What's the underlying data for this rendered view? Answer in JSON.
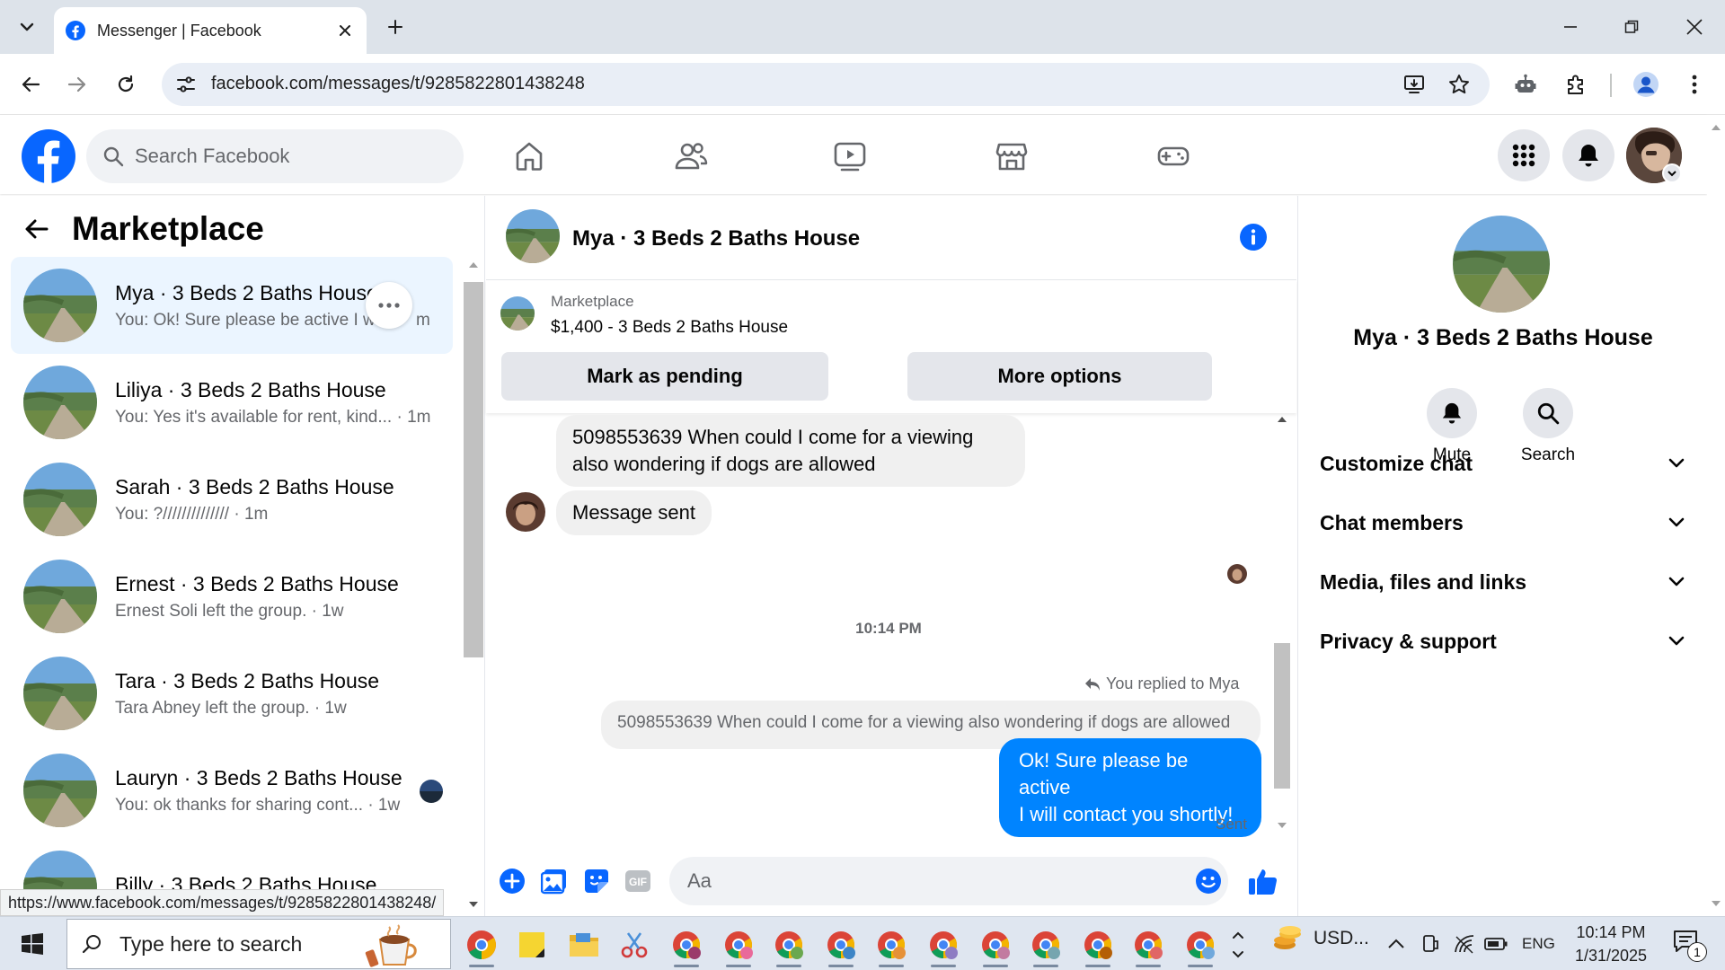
{
  "browser": {
    "tab_title": "Messenger | Facebook",
    "url": "facebook.com/messages/t/9285822801438248",
    "status_url": "https://www.facebook.com/messages/t/9285822801438248/"
  },
  "fb_header": {
    "search_placeholder": "Search Facebook"
  },
  "sidebar": {
    "title": "Marketplace",
    "conversations": [
      {
        "name": "Mya · 3 Beds 2 Baths House",
        "preview": "You: Ok! Sure please be active I w",
        "time": "m",
        "active": true
      },
      {
        "name": "Liliya · 3 Beds 2 Baths House",
        "preview": "You: Yes it's available for rent, kind...",
        "time": "· 1m"
      },
      {
        "name": "Sarah · 3 Beds 2 Baths House",
        "preview": "You: ?//////////////",
        "time": "· 1m"
      },
      {
        "name": "Ernest · 3 Beds 2 Baths House",
        "preview": "Ernest Soli left the group.",
        "time": "· 1w"
      },
      {
        "name": "Tara · 3 Beds 2 Baths House",
        "preview": "Tara Abney left the group.",
        "time": "· 1w"
      },
      {
        "name": "Lauryn · 3 Beds 2 Baths House",
        "preview": "You: ok thanks for sharing cont...",
        "time": "· 1w"
      },
      {
        "name": "Billy · 3 Beds 2 Baths House",
        "preview": "",
        "time": ""
      }
    ]
  },
  "chat": {
    "title": "Mya · 3 Beds 2 Baths House",
    "marketplace_label": "Marketplace",
    "listing": "$1,400 - 3 Beds 2 Baths House",
    "mark_pending": "Mark as pending",
    "more_options": "More options",
    "msg_incoming_1": "5098553639 When could I come for a viewing also wondering if dogs are allowed",
    "msg_incoming_2": "Message sent",
    "timestamp": "10:14 PM",
    "replied_to": "You replied to Mya",
    "quoted": "5098553639 When could I come for a viewing also wondering if dogs are allowed",
    "msg_outgoing_line1": "Ok! Sure please be active",
    "msg_outgoing_line2": "I will contact you shortly!",
    "sent_status": "Sent",
    "composer_placeholder": "Aa"
  },
  "info_panel": {
    "name": "Mya · 3 Beds 2 Baths House",
    "actions": [
      {
        "label": "Mute",
        "icon": "bell-icon"
      },
      {
        "label": "Search",
        "icon": "search-icon"
      }
    ],
    "sections": [
      "Customize chat",
      "Chat members",
      "Media, files and links",
      "Privacy & support"
    ]
  },
  "taskbar": {
    "search_placeholder": "Type here to search",
    "ticker": "USD...",
    "language": "ENG",
    "time": "10:14 PM",
    "date": "1/31/2025",
    "notifications": "1"
  },
  "colors": {
    "fb_blue": "#0866ff",
    "messenger_blue": "#0084ff",
    "active_row": "#ebf5ff"
  }
}
